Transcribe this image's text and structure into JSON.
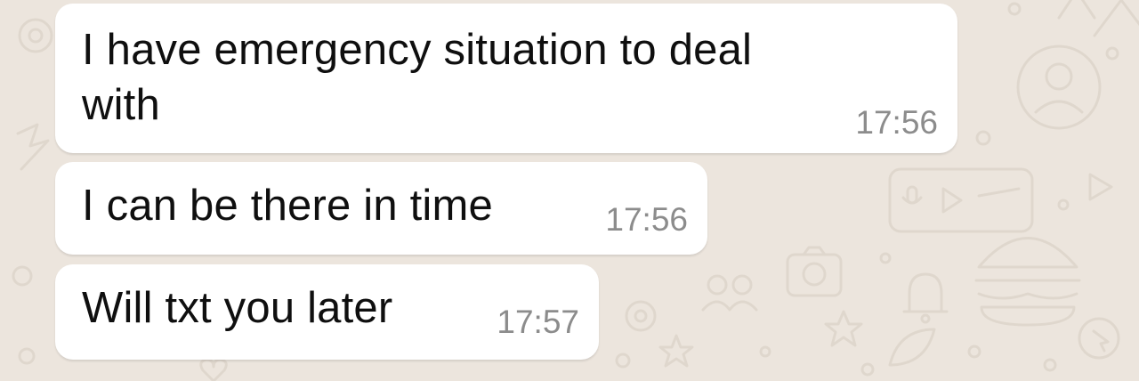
{
  "chat": {
    "messages": [
      {
        "text": "I have emergency situation to deal with",
        "time": "17:56"
      },
      {
        "text": "I can be there in time",
        "time": "17:56"
      },
      {
        "text": "Will txt you later",
        "time": "17:57"
      }
    ]
  },
  "theme": {
    "background": "#ece5dd",
    "bubble": "#ffffff",
    "text": "#0f0f0f",
    "timestamp": "#8c8c8c",
    "doodle": "#d8cfc4"
  },
  "wallpaper_icons": [
    "gear-icon",
    "avatar-icon",
    "camera-icon",
    "burger-icon",
    "bell-icon",
    "star-icon",
    "lightning-icon",
    "video-icon",
    "mic-icon",
    "play-icon",
    "cursor-icon",
    "heart-icon",
    "people-icon"
  ]
}
